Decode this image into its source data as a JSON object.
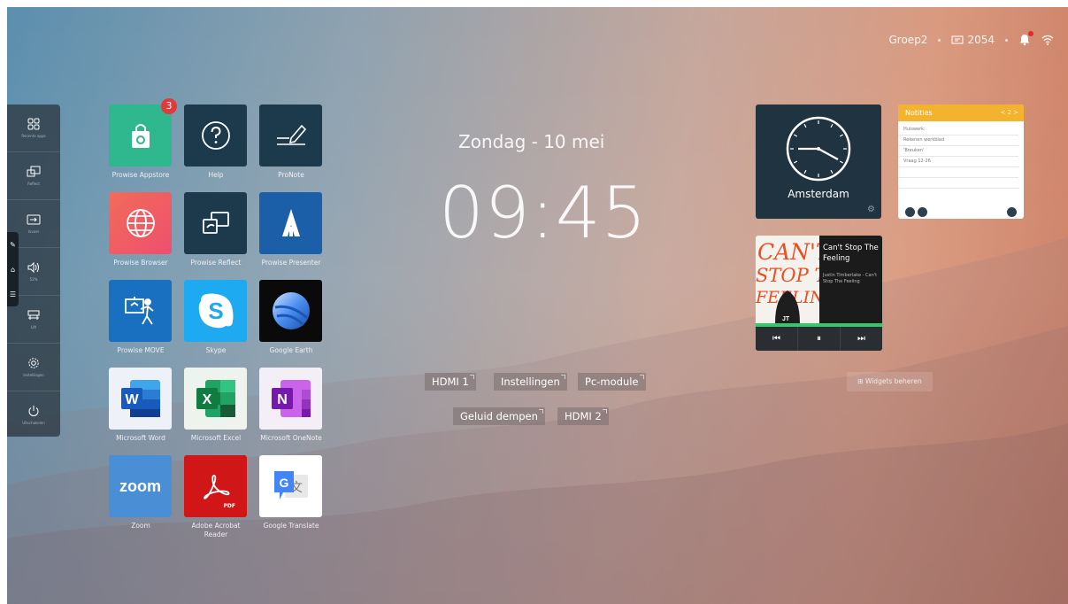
{
  "status_bar": {
    "group": "Groep2",
    "room": "2054"
  },
  "sidebar": {
    "items": [
      {
        "label": "Recente apps",
        "icon": "apps-icon"
      },
      {
        "label": "Reflect",
        "icon": "reflect-icon"
      },
      {
        "label": "Invoer",
        "icon": "input-icon"
      },
      {
        "label": "52%",
        "icon": "volume-icon"
      },
      {
        "label": "Lift",
        "icon": "lift-icon"
      },
      {
        "label": "Instellingen",
        "icon": "settings-icon"
      },
      {
        "label": "Uitschakelen",
        "icon": "power-icon"
      }
    ]
  },
  "apps": [
    {
      "name": "Prowise Appstore",
      "badge": "3"
    },
    {
      "name": "Help"
    },
    {
      "name": "ProNote"
    },
    {
      "name": "Prowise Browser"
    },
    {
      "name": "Prowise Reflect"
    },
    {
      "name": "Prowise Presenter"
    },
    {
      "name": "Prowise MOVE"
    },
    {
      "name": "Skype"
    },
    {
      "name": "Google Earth"
    },
    {
      "name": "Microsoft Word"
    },
    {
      "name": "Microsoft Excel"
    },
    {
      "name": "Microsoft OneNote"
    },
    {
      "name": "Zoom",
      "logo_text": "zoom"
    },
    {
      "name": "Adobe Acrobat Reader",
      "logo_text": "PDF"
    },
    {
      "name": "Google Translate"
    }
  ],
  "clock": {
    "date": "Zondag - 10 mei",
    "time": "09:45"
  },
  "shortcuts": [
    "HDMI 1",
    "Instellingen",
    "Pc-module",
    "Geluid dempen",
    "HDMI 2"
  ],
  "clock_widget": {
    "city": "Amsterdam"
  },
  "notes_widget": {
    "title": "Notities",
    "page": "< 2 >",
    "lines": [
      "Huiswerk:",
      "Rekenen werkblad",
      "'Breuken'",
      "Vraag 12-26"
    ]
  },
  "music_widget": {
    "song": "Can't Stop The Feeling",
    "artist_line": "Justin Timberlake - Can't Stop The Feeling",
    "cover_text": "CAN'T STOP THE FEELING",
    "cover_initials": "JT",
    "progress": 1.0
  },
  "widgets_button": "Widgets beheren",
  "colors": {
    "accent_notes": "#f4b32e",
    "badge_red": "#e23a3a",
    "music_progress": "#34c86a"
  }
}
